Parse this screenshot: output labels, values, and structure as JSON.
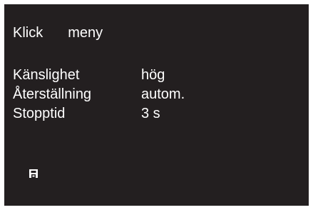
{
  "header": {
    "click_label": "Klick",
    "menu_label": "meny"
  },
  "settings": [
    {
      "label": "Känslighet",
      "value": "hög"
    },
    {
      "label": "Återställning",
      "value": "autom."
    },
    {
      "label": "Stopptid",
      "value": "3 s"
    }
  ],
  "icons": {
    "status_icon": "save-icon"
  },
  "colors": {
    "screen_background": "#231f20",
    "text": "#ffffff"
  }
}
